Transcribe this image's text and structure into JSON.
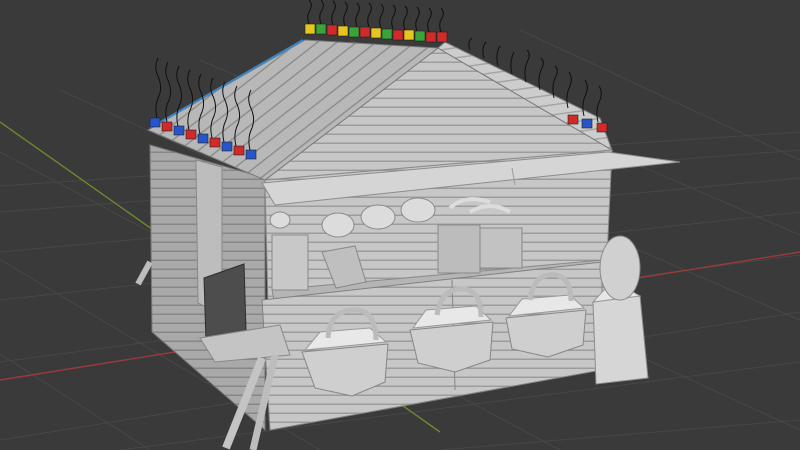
{
  "viewport": {
    "background": "#3a3a3a",
    "grid_color": "#474747",
    "x_axis_color": "#9b3a3a",
    "y_axis_color": "#6b8a2e"
  },
  "model": {
    "base_color": "#c9c9c9",
    "roof_blocks_colors": [
      "#d12a2a",
      "#2a55c8",
      "#e6c51f",
      "#3aa33a"
    ],
    "roof_edge_highlight": "#3c86c8"
  }
}
